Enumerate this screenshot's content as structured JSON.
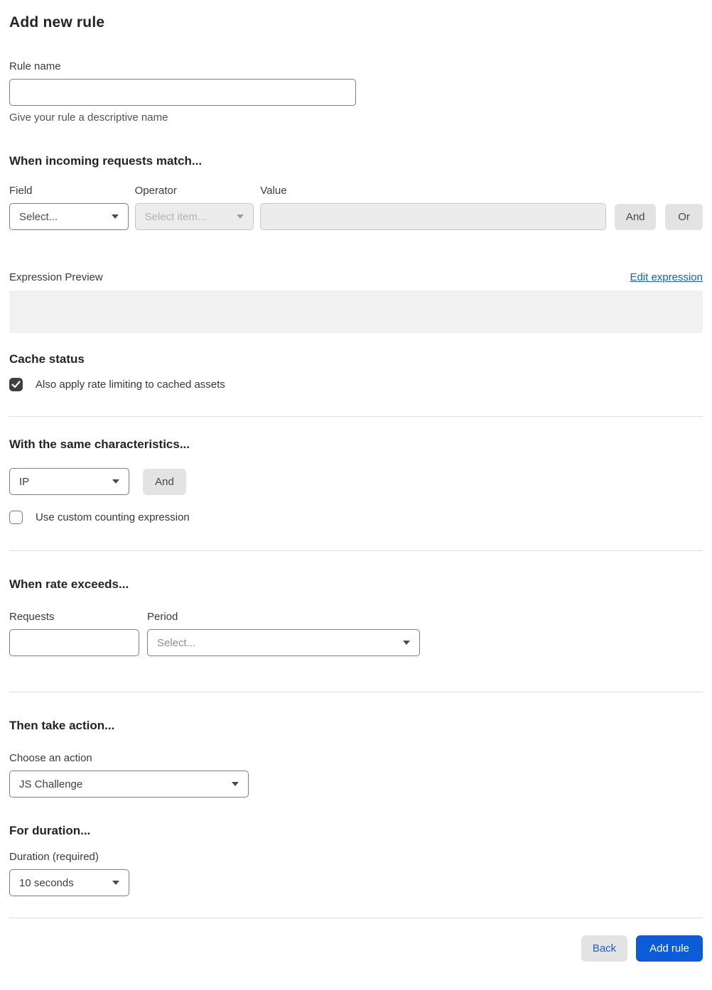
{
  "page": {
    "title": "Add new rule"
  },
  "rule_name": {
    "label": "Rule name",
    "value": "",
    "helper": "Give your rule a descriptive name"
  },
  "match": {
    "heading": "When incoming requests match...",
    "field": {
      "label": "Field",
      "selected": "Select..."
    },
    "operator": {
      "label": "Operator",
      "selected": "Select item...",
      "disabled": true
    },
    "value": {
      "label": "Value",
      "value": "",
      "disabled": true
    },
    "and_button": "And",
    "or_button": "Or"
  },
  "expression": {
    "label": "Expression Preview",
    "edit_link": "Edit expression",
    "preview_value": ""
  },
  "cache": {
    "heading": "Cache status",
    "checkbox_label": "Also apply rate limiting to cached assets",
    "checked": true
  },
  "characteristics": {
    "heading": "With the same characteristics...",
    "selected": "IP",
    "and_button": "And",
    "checkbox_label": "Use custom counting expression",
    "checked": false
  },
  "rate": {
    "heading": "When rate exceeds...",
    "requests": {
      "label": "Requests",
      "value": ""
    },
    "period": {
      "label": "Period",
      "selected": "Select..."
    }
  },
  "action": {
    "heading": "Then take action...",
    "label": "Choose an action",
    "selected": "JS Challenge"
  },
  "duration": {
    "heading": "For duration...",
    "label": "Duration (required)",
    "selected": "10 seconds"
  },
  "footer": {
    "back_button": "Back",
    "submit_button": "Add rule"
  },
  "colors": {
    "primary_blue": "#0b5cd6",
    "link_blue": "#1a5dc8",
    "back_text_blue": "#2360c5",
    "checkbox_dark": "#3d3f40",
    "disabled_bg": "#ececec",
    "preview_bg": "#f1f1f1",
    "button_gray": "#e3e3e3",
    "divider": "#dedede"
  }
}
